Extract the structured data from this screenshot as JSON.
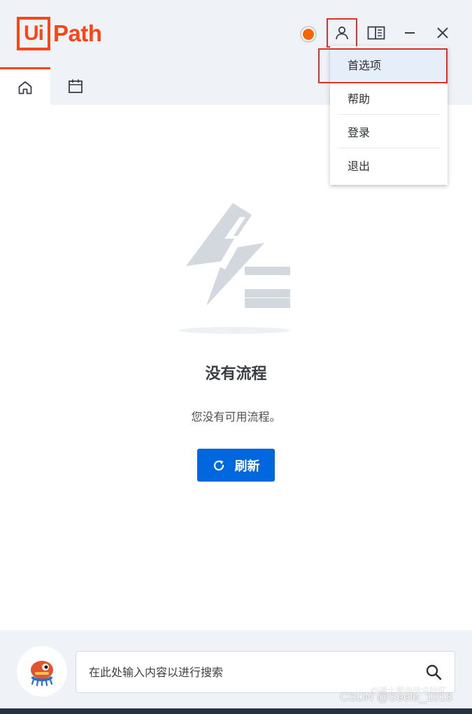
{
  "app": {
    "logo_ui": "Ui",
    "logo_path": "Path",
    "brand_color": "#fa4616"
  },
  "header": {
    "status_color": "#fa6400",
    "icons": [
      "status-dot-icon",
      "user-icon",
      "panel-toggle-icon",
      "minimize-icon",
      "close-icon"
    ]
  },
  "tabs": [
    {
      "name": "home",
      "icon": "home-icon",
      "active": true
    },
    {
      "name": "calendar",
      "icon": "calendar-icon",
      "active": false
    }
  ],
  "user_menu": {
    "items": [
      {
        "label": "首选项",
        "selected": true
      },
      {
        "label": "帮助",
        "selected": false
      },
      {
        "label": "登录",
        "selected": false
      },
      {
        "label": "退出",
        "selected": false
      }
    ]
  },
  "empty_state": {
    "title": "没有流程",
    "description": "您没有可用流程。",
    "refresh_label": "刷新",
    "refresh_icon": "refresh-icon",
    "accent_color": "#0067df"
  },
  "footer": {
    "search_placeholder": "在此处输入内容以进行搜索",
    "search_icon": "search-icon"
  },
  "watermark": {
    "text": "CSDN @Seele_1018",
    "small_text": "@稀土掘金技术社区"
  }
}
